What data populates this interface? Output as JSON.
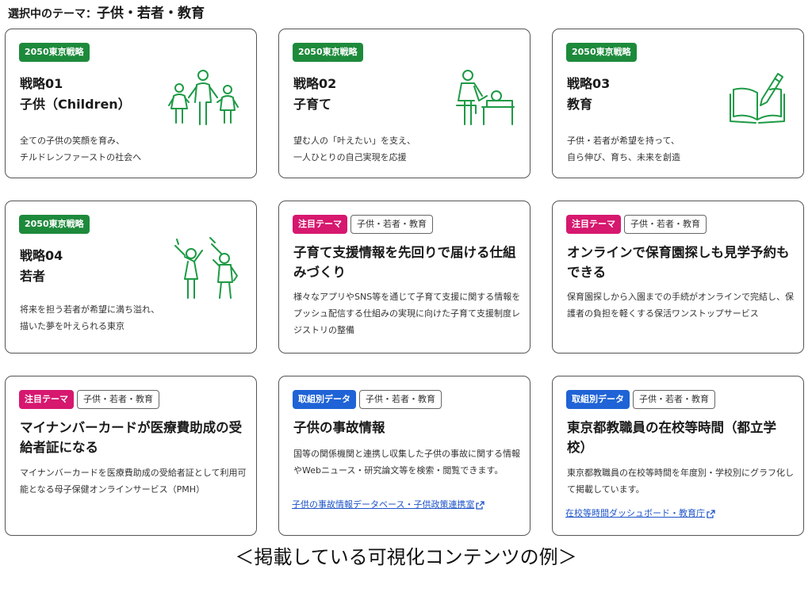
{
  "header": {
    "label": "選択中のテーマ：",
    "theme": "子供・若者・教育"
  },
  "tags": {
    "strategy": "2050東京戦略",
    "focus": "注目テーマ",
    "data": "取組別データ",
    "category": "子供・若者・教育"
  },
  "cards": [
    {
      "number": "戦略01",
      "title": "子供（Children）",
      "desc": [
        "全ての子供の笑顔を育み、",
        "チルドレンファーストの社会へ"
      ],
      "icon": "children-family-icon"
    },
    {
      "number": "戦略02",
      "title": "子育て",
      "desc": [
        "望む人の「叶えたい」を支え、",
        "一人ひとりの自己実現を応援"
      ],
      "icon": "childcare-caregiver-icon"
    },
    {
      "number": "戦略03",
      "title": "教育",
      "desc": [
        "子供・若者が希望を持って、",
        "自ら伸び、育ち、未来を創造"
      ],
      "icon": "open-book-pen-icon"
    },
    {
      "number": "戦略04",
      "title": "若者",
      "desc": [
        "将来を担う若者が希望に満ち溢れ、",
        "描いた夢を叶えられる東京"
      ],
      "icon": "young-people-cheering-icon"
    },
    {
      "title": "子育て支援情報を先回りで届ける仕組みづくり",
      "desc": "様々なアプリやSNS等を通じて子育て支援に関する情報をプッシュ配信する仕組みの実現に向けた子育て支援制度レジストリの整備"
    },
    {
      "title": "オンラインで保育園探しも見学予約もできる",
      "desc": "保育園探しから入園までの手続がオンラインで完結し、保護者の負担を軽くする保活ワンストップサービス"
    },
    {
      "title": "マイナンバーカードが医療費助成の受給者証になる",
      "desc": "マイナンバーカードを医療費助成の受給者証として利用可能となる母子保健オンラインサービス（PMH）"
    },
    {
      "title": "子供の事故情報",
      "desc": "国等の関係機関と連携し収集した子供の事故に関する情報やWebニュース・研究論文等を検索・閲覧できます。",
      "link": "子供の事故情報データベース・子供政策連携室"
    },
    {
      "title": "東京都教職員の在校等時間（都立学校）",
      "desc": "東京都教職員の在校等時間を年度別・学校別にグラフ化して掲載しています。",
      "link": "在校等時間ダッシュボード・教育庁"
    }
  ],
  "caption": "＜掲載している可視化コンテンツの例＞",
  "colors": {
    "strategy": "#1d8a3b",
    "focus": "#d6186f",
    "data": "#1f63d6",
    "link": "#1f55c8",
    "icon": "#1d9a45"
  }
}
